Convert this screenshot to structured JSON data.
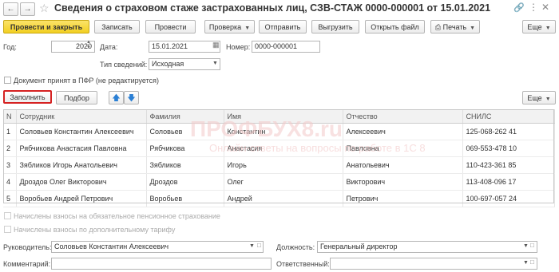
{
  "window": {
    "title": "Сведения о страховом стаже застрахованных лиц, СЗВ-СТАЖ 0000-000001 от 15.01.2021"
  },
  "toolbar": {
    "post_close": "Провести и закрыть",
    "save": "Записать",
    "post": "Провести",
    "check": "Проверка",
    "send": "Отправить",
    "upload": "Выгрузить",
    "open_file": "Открыть файл",
    "print": "Печать",
    "more": "Еще"
  },
  "form": {
    "year_label": "Год:",
    "year_value": "2020",
    "date_label": "Дата:",
    "date_value": "15.01.2021",
    "number_label": "Номер:",
    "number_value": "0000-000001",
    "type_label": "Тип сведений:",
    "type_value": "Исходная",
    "pfr_checkbox": "Документ принят в ПФР (не редактируется)"
  },
  "table_toolbar": {
    "fill": "Заполнить",
    "select": "Подбор",
    "more": "Еще"
  },
  "table": {
    "headers": [
      "N",
      "Сотрудник",
      "Фамилия",
      "Имя",
      "Отчество",
      "СНИЛС"
    ],
    "rows": [
      [
        "1",
        "Соловьев Константин Алексеевич",
        "Соловьев",
        "Константин",
        "Алексеевич",
        "125-068-262 41"
      ],
      [
        "2",
        "Рябчикова Анастасия Павловна",
        "Рябчикова",
        "Анастасия",
        "Павловна",
        "069-553-478 10"
      ],
      [
        "3",
        "Зябликов Игорь Анатольевич",
        "Зябликов",
        "Игорь",
        "Анатольевич",
        "110-423-361 85"
      ],
      [
        "4",
        "Дроздов Олег Викторович",
        "Дроздов",
        "Олег",
        "Викторович",
        "113-408-096 17"
      ],
      [
        "5",
        "Воробьев Андрей Петрович",
        "Воробьев",
        "Андрей",
        "Петрович",
        "100-697-057 24"
      ]
    ]
  },
  "watermark": {
    "brand": "ПРОФБУХ8.ru",
    "tagline": "Онлайн-ответы на вопросы по работе в 1С 8"
  },
  "options": {
    "mandatory_pension": "Начислены взносы на обязательное пенсионное страхование",
    "additional_tariff": "Начислены взносы по дополнительному тарифу"
  },
  "footer": {
    "head_label": "Руководитель:",
    "head_value": "Соловьев Константин Алексеевич",
    "position_label": "Должность:",
    "position_value": "Генеральный директор",
    "comment_label": "Комментарий:",
    "comment_value": "",
    "responsible_label": "Ответственный:",
    "responsible_value": ""
  }
}
